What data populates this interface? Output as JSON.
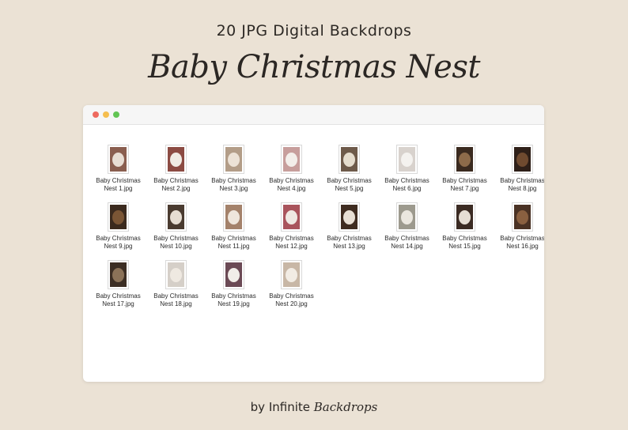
{
  "header": {
    "subtitle": "20 JPG Digital Backdrops",
    "title": "Baby Christmas Nest"
  },
  "window": {
    "controls": [
      "close",
      "minimize",
      "zoom"
    ]
  },
  "files": [
    {
      "line1": "Baby Christmas",
      "line2": "Nest 1.jpg",
      "bg": "#8a5e4f",
      "nest": "#e8ddd3"
    },
    {
      "line1": "Baby Christmas",
      "line2": "Nest 2.jpg",
      "bg": "#8c4b43",
      "nest": "#f0ebe4"
    },
    {
      "line1": "Baby Christmas",
      "line2": "Nest 3.jpg",
      "bg": "#b39d88",
      "nest": "#ece2d6"
    },
    {
      "line1": "Baby Christmas",
      "line2": "Nest 4.jpg",
      "bg": "#c79e9c",
      "nest": "#f3eeea"
    },
    {
      "line1": "Baby Christmas",
      "line2": "Nest 5.jpg",
      "bg": "#6e5a4a",
      "nest": "#e5dccd"
    },
    {
      "line1": "Baby Christmas",
      "line2": "Nest 6.jpg",
      "bg": "#d8d2cd",
      "nest": "#f4f2ef"
    },
    {
      "line1": "Baby Christmas",
      "line2": "Nest 7.jpg",
      "bg": "#3a2a1f",
      "nest": "#8d6b4a"
    },
    {
      "line1": "Baby Christmas",
      "line2": "Nest 8.jpg",
      "bg": "#2e1f18",
      "nest": "#6f4a2f"
    },
    {
      "line1": "Baby Christmas",
      "line2": "Nest 9.jpg",
      "bg": "#3b2a1e",
      "nest": "#7a5535"
    },
    {
      "line1": "Baby Christmas",
      "line2": "Nest 10.jpg",
      "bg": "#4a3b30",
      "nest": "#e6ddd2"
    },
    {
      "line1": "Baby Christmas",
      "line2": "Nest 11.jpg",
      "bg": "#a4826b",
      "nest": "#efe6dc"
    },
    {
      "line1": "Baby Christmas",
      "line2": "Nest 12.jpg",
      "bg": "#a9545c",
      "nest": "#efe8e2"
    },
    {
      "line1": "Baby Christmas",
      "line2": "Nest 13.jpg",
      "bg": "#3f2c20",
      "nest": "#e8dfd4"
    },
    {
      "line1": "Baby Christmas",
      "line2": "Nest 14.jpg",
      "bg": "#9d9a8e",
      "nest": "#ebe7df"
    },
    {
      "line1": "Baby Christmas",
      "line2": "Nest 15.jpg",
      "bg": "#3b2b23",
      "nest": "#e6ded4"
    },
    {
      "line1": "Baby Christmas",
      "line2": "Nest 16.jpg",
      "bg": "#4a3224",
      "nest": "#8a6040"
    },
    {
      "line1": "Baby Christmas",
      "line2": "Nest 17.jpg",
      "bg": "#3c2e24",
      "nest": "#8b7258"
    },
    {
      "line1": "Baby Christmas",
      "line2": "Nest 18.jpg",
      "bg": "#d5cfc8",
      "nest": "#efe9e1"
    },
    {
      "line1": "Baby Christmas",
      "line2": "Nest 19.jpg",
      "bg": "#6b4a55",
      "nest": "#f1ede8"
    },
    {
      "line1": "Baby Christmas",
      "line2": "Nest 20.jpg",
      "bg": "#c8b7a6",
      "nest": "#f2ece4"
    }
  ],
  "footer": {
    "by": "by Infinite",
    "brand": "Backdrops"
  }
}
